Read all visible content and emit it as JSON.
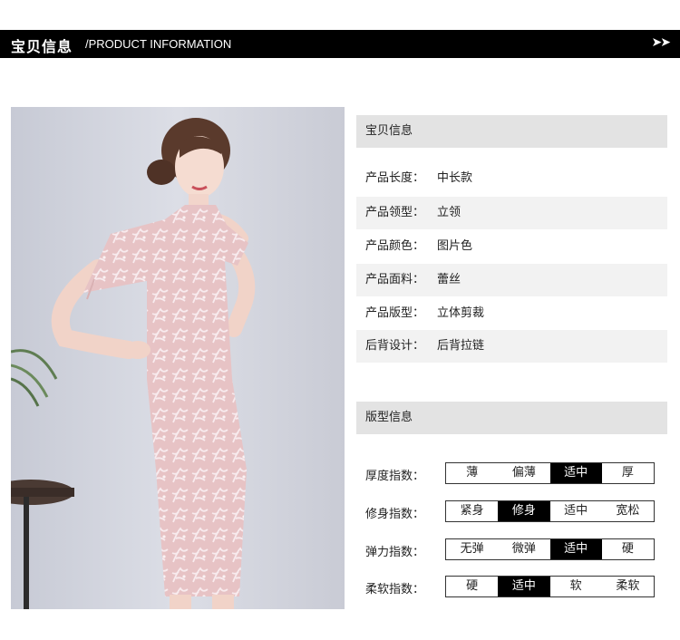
{
  "header": {
    "title_cn": "宝贝信息",
    "title_en": "/PRODUCT INFORMATION",
    "arrows": "➤➤"
  },
  "details": {
    "heading": "宝贝信息",
    "rows": [
      {
        "label": "产品长度：",
        "value": "中长款"
      },
      {
        "label": "产品领型：",
        "value": "立领"
      },
      {
        "label": "产品颜色：",
        "value": "图片色"
      },
      {
        "label": "产品面料：",
        "value": "蕾丝"
      },
      {
        "label": "产品版型：",
        "value": "立体剪裁"
      },
      {
        "label": "后背设计：",
        "value": "后背拉链"
      }
    ]
  },
  "fit": {
    "heading": "版型信息",
    "scales": [
      {
        "label": "厚度指数：",
        "options": [
          "薄",
          "偏薄",
          "适中",
          "厚"
        ],
        "selected": 2
      },
      {
        "label": "修身指数：",
        "options": [
          "紧身",
          "修身",
          "适中",
          "宽松"
        ],
        "selected": 1
      },
      {
        "label": "弹力指数：",
        "options": [
          "无弹",
          "微弹",
          "适中",
          "硬"
        ],
        "selected": 2
      },
      {
        "label": "柔软指数：",
        "options": [
          "硬",
          "适中",
          "软",
          "柔软"
        ],
        "selected": 1
      }
    ]
  },
  "colors": {
    "dress": "#e8c6c8",
    "selected_bg": "#000000"
  }
}
